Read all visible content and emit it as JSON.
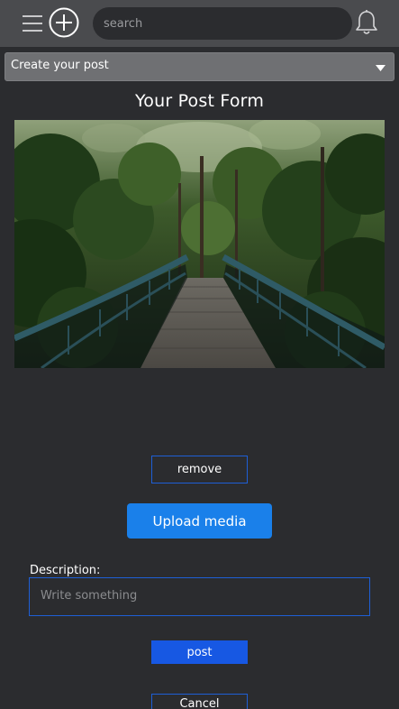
{
  "header": {
    "menu_icon": "hamburger-menu-icon",
    "add_icon": "plus-circle-icon",
    "search": {
      "placeholder": "search",
      "value": ""
    },
    "notification_icon": "bell-icon"
  },
  "post_type_select": {
    "selected": "Create your post",
    "icon": "chevron-down-icon"
  },
  "form": {
    "title": "Your Post Form",
    "image": {
      "alt": "Wooden footbridge with teal railings leading into a dense green forest"
    },
    "remove_label": "remove",
    "upload_label": "Upload media",
    "description_label": "Description:",
    "description_placeholder": "Write something",
    "description_value": "",
    "post_label": "post",
    "cancel_label": "Cancel"
  },
  "colors": {
    "background": "#2b2c2f",
    "topbar": "#4a4b4e",
    "accent_blue": "#1a80ea",
    "border_blue": "#1e5fd6",
    "post_button_blue": "#1758e3"
  }
}
